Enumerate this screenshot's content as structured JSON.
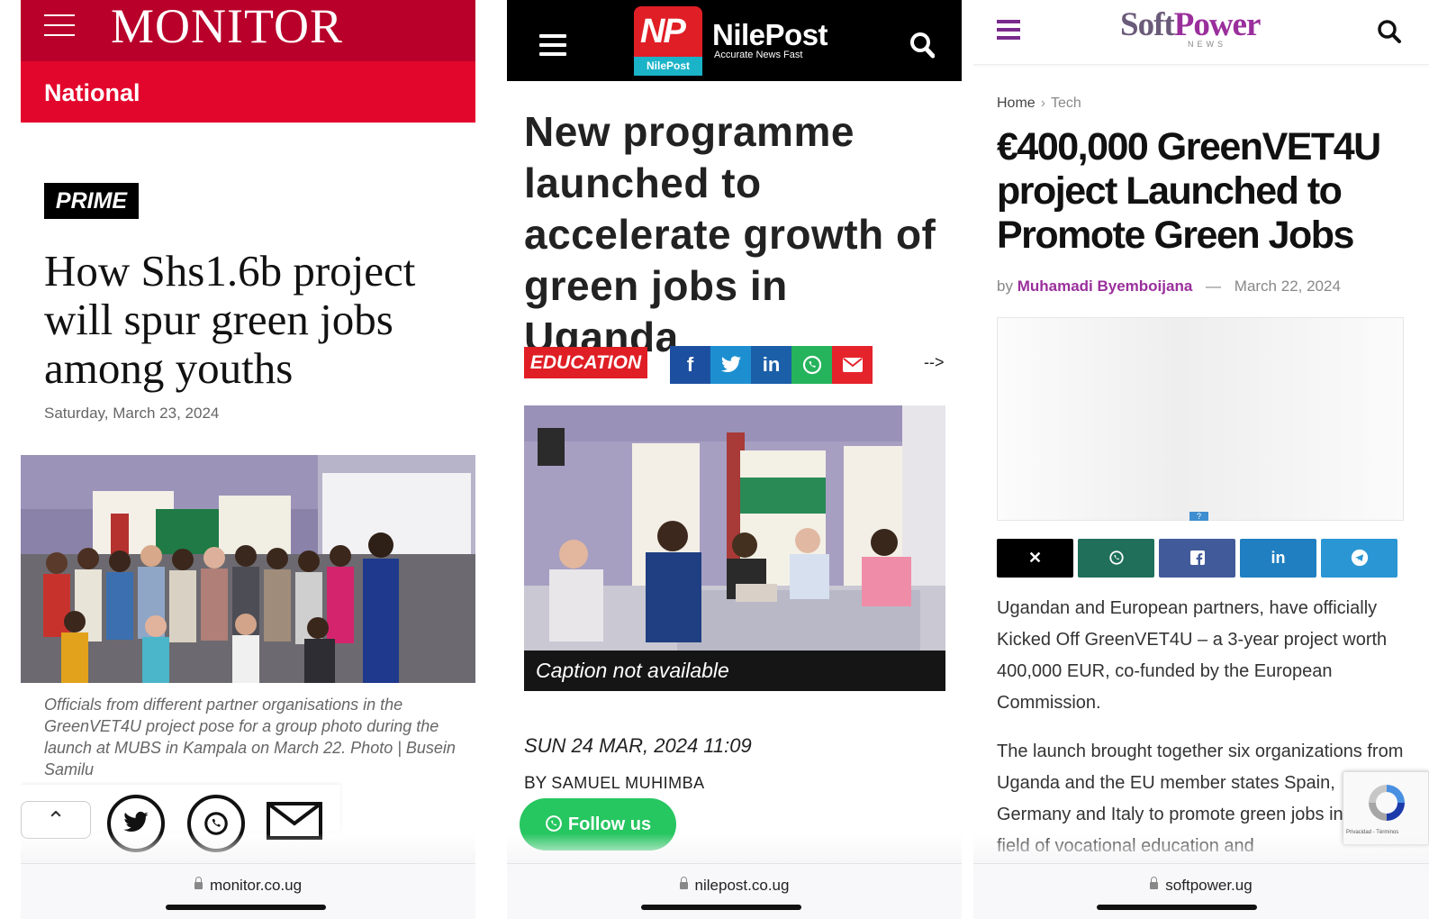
{
  "monitor": {
    "brand": "MONITOR",
    "section": "National",
    "badge": "PRIME",
    "title": "How Shs1.6b project will spur green jobs among youths",
    "date": "Saturday, March 23, 2024",
    "caption": "Officials from different partner organisations in the GreenVET4U project pose for a group photo during the launch at MUBS in Kampala on March 22. Photo | Busein Samilu",
    "share_icons": [
      "chevron-up-icon",
      "twitter-icon",
      "whatsapp-icon",
      "mail-icon"
    ],
    "url": "monitor.co.ug",
    "colors": {
      "header": "#b8002a",
      "section_bar": "#e3062c"
    }
  },
  "nilepost": {
    "logo_mark": "NP",
    "logo_tag": "NilePost",
    "brand": "NilePost",
    "tagline": "Accurate News Fast",
    "title": "New programme launched to accelerate growth of green jobs in Uganda",
    "category": "EDUCATION",
    "share_icons": [
      "facebook-icon",
      "twitter-icon",
      "linkedin-icon",
      "whatsapp-icon",
      "mail-icon"
    ],
    "stray_text": "-->",
    "caption": "Caption not available",
    "date": "SUN 24 MAR, 2024 11:09",
    "by_label": "BY",
    "author": "SAMUEL MUHIMBA",
    "follow_label": "Follow us",
    "url": "nilepost.co.ug",
    "colors": {
      "accent": "#e01e25",
      "follow": "#26c660"
    }
  },
  "softpower": {
    "brand_a": "Soft",
    "brand_b": "Power",
    "brand_sub": "NEWS",
    "breadcrumb": [
      "Home",
      "Tech"
    ],
    "title": "€400,000 GreenVET4U project Launched to Promote Green Jobs",
    "by_label": "by",
    "author": "Muhamadi Byemboijana",
    "dash": "—",
    "date": "March 22, 2024",
    "ad_badge": "?",
    "share_icons": [
      "x-icon",
      "whatsapp-icon",
      "facebook-icon",
      "linkedin-icon",
      "telegram-icon"
    ],
    "paragraphs": [
      "Ugandan and European partners, have officially Kicked Off GreenVET4U – a 3-year project worth 400,000 EUR, co-funded by the European Commission.",
      "The launch brought together six organizations from Uganda and the EU member states Spain, Germany and Italy to promote green jobs in the field of vocational education and"
    ],
    "recaptcha_text": "Privacidad - Términos",
    "url": "softpower.ug",
    "colors": {
      "brand": "#9a2f9c"
    }
  }
}
